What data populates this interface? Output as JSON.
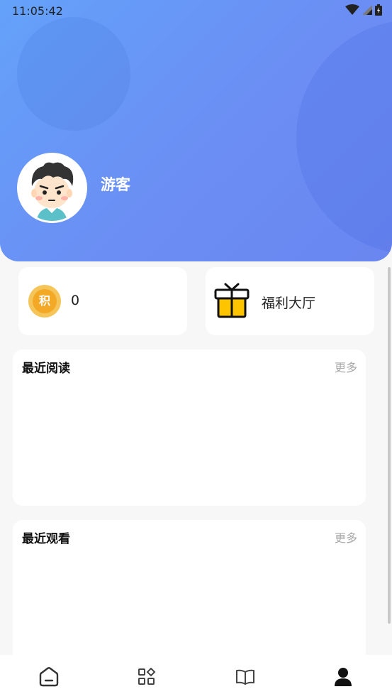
{
  "status_bar": {
    "time": "11:05:42",
    "icons": [
      "wifi-icon",
      "signal-icon",
      "battery-icon"
    ]
  },
  "header": {
    "username": "游客",
    "avatar": "cartoon-boy-avatar"
  },
  "stats": {
    "points_icon_char": "积",
    "points_value": "0",
    "welfare_label": "福利大厅"
  },
  "sections": {
    "recent_reading": {
      "title": "最近阅读",
      "more": "更多"
    },
    "recent_watching": {
      "title": "最近观看",
      "more": "更多"
    }
  },
  "bottom_nav": {
    "items": [
      {
        "icon": "home-icon",
        "selected": false
      },
      {
        "icon": "category-icon",
        "selected": false
      },
      {
        "icon": "book-icon",
        "selected": false
      },
      {
        "icon": "profile-icon",
        "selected": true
      }
    ]
  },
  "colors": {
    "header_gradient_start": "#64a2fa",
    "header_gradient_end": "#6a86f0",
    "points_coin": "#f3a826",
    "gift_yellow": "#ffc400"
  }
}
